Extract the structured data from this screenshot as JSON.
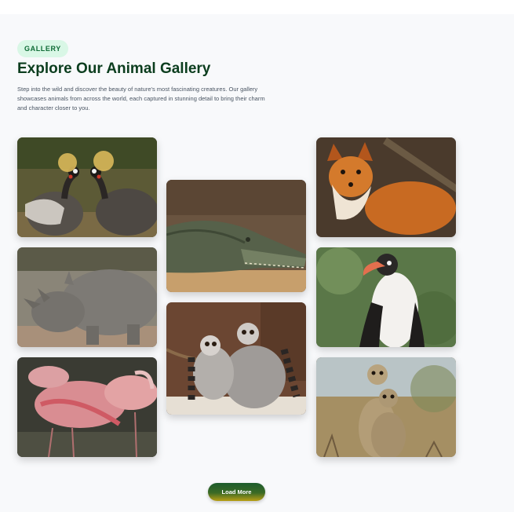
{
  "header": {
    "badge": "GALLERY",
    "title": "Explore Our Animal Gallery",
    "description": "Step into the wild and discover the beauty of nature's most fascinating creatures. Our gallery showcases animals from across the world, each captured in stunning detail to bring their charm and character closer to you."
  },
  "gallery": {
    "images": [
      {
        "subject": "crowned-cranes"
      },
      {
        "subject": "rhinoceros"
      },
      {
        "subject": "flamingos"
      },
      {
        "subject": "crocodile"
      },
      {
        "subject": "ring-tailed-lemurs"
      },
      {
        "subject": "red-fox"
      },
      {
        "subject": "hornbill"
      },
      {
        "subject": "meerkats"
      }
    ]
  },
  "actions": {
    "load_more": "Load More"
  },
  "colors": {
    "badge_bg": "#d9f7e6",
    "badge_text": "#0f6b36",
    "title": "#0b3d1e",
    "button_start": "#1d5c2d",
    "button_end": "#b89e16"
  }
}
